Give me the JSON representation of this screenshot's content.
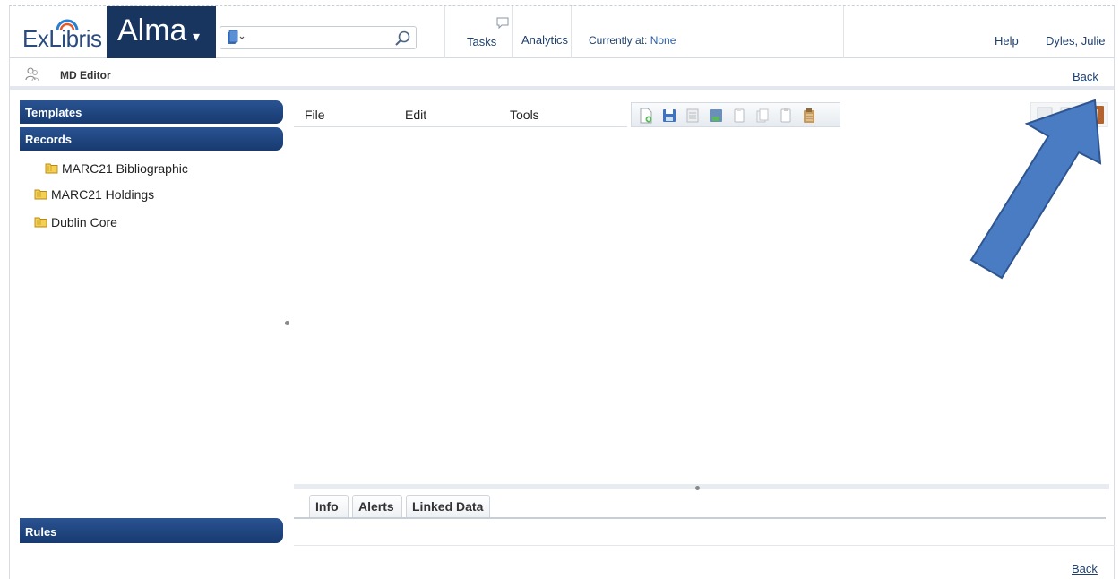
{
  "header": {
    "brand_left": "ExLibris",
    "product": "Alma",
    "search_value": "",
    "tasks_label": "Tasks",
    "analytics_label": "Analytics",
    "currently_label": "Currently at:",
    "currently_value": "None",
    "help_label": "Help",
    "user_name": "Dyles, Julie"
  },
  "subheader": {
    "title": "MD Editor",
    "back_label": "Back"
  },
  "left_panel": {
    "templates_label": "Templates",
    "records_label": "Records",
    "records_items": [
      {
        "label": "MARC21 Bibliographic"
      },
      {
        "label": "MARC21 Holdings"
      },
      {
        "label": "Dublin Core"
      }
    ],
    "rules_label": "Rules"
  },
  "editor": {
    "menus": [
      {
        "label": "File"
      },
      {
        "label": "Edit"
      },
      {
        "label": "Tools"
      }
    ]
  },
  "bottom_tabs": [
    {
      "label": "Info"
    },
    {
      "label": "Alerts"
    },
    {
      "label": "Linked Data"
    }
  ],
  "footer": {
    "back_label": "Back"
  },
  "colors": {
    "brand_navy": "#17355f",
    "panel_header": "#1f457f",
    "annotation_arrow": "#4a7cc4"
  }
}
